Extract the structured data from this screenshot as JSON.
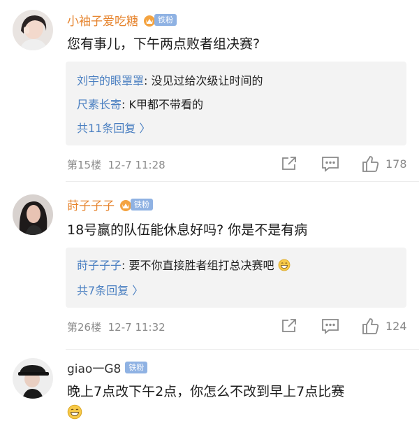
{
  "comments": [
    {
      "username": "小袖子爱吃糖",
      "badge": "铁粉",
      "text": "您有事儿，下午两点败者组决赛?",
      "replies": [
        {
          "name": "刘宇的眼罩罩",
          "text": ": 没见过给次级让时间的"
        },
        {
          "name": "尺素长寄",
          "text": ": K甲都不带看的"
        }
      ],
      "more": "共11条回复 〉",
      "floor": "第15楼",
      "date": "12-7 11:28",
      "likes": "178"
    },
    {
      "username": "莳子子子",
      "badge": "铁粉",
      "text": "18号赢的队伍能休息好吗? 你是不是有病",
      "replies": [
        {
          "name": "莳子子子",
          "text": ": 要不你直接胜者组打总决赛吧"
        }
      ],
      "more": "共7条回复 〉",
      "floor": "第26楼",
      "date": "12-7 11:32",
      "likes": "124"
    },
    {
      "username": "giao一G8",
      "badge": "铁粉",
      "text": "晚上7点改下午2点，你怎么不改到早上7点比赛"
    }
  ],
  "colors": {
    "username": "#e6842e",
    "reply_name": "#4a7fc1",
    "badge": "#8fb2e3",
    "meta": "#8a8a8a"
  },
  "icons": [
    "crown-icon",
    "share-icon",
    "comment-icon",
    "like-icon",
    "grin-emoji-icon"
  ]
}
